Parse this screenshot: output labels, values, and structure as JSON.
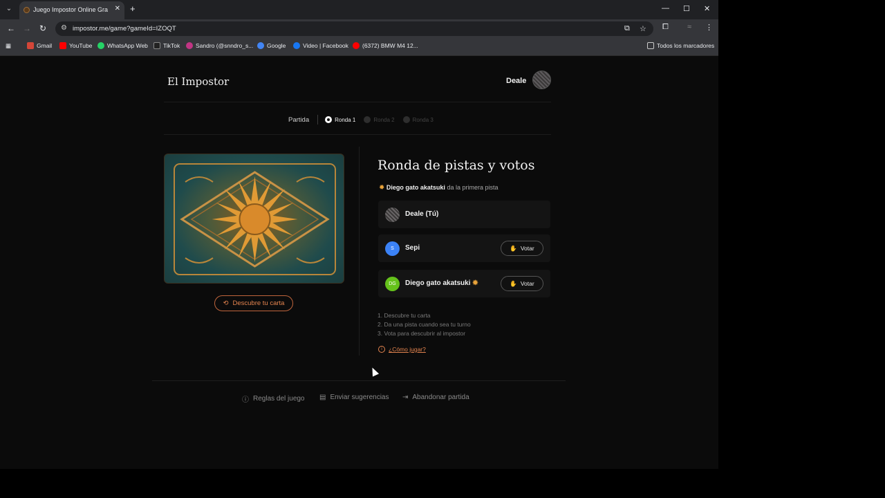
{
  "browser": {
    "tab_title": "Juego Impostor Online Gratis -",
    "url": "impostor.me/game?gameId=IZOQT",
    "bookmarks": [
      {
        "label": "Gmail",
        "color": "#d44638"
      },
      {
        "label": "YouTube",
        "color": "#ff0000"
      },
      {
        "label": "WhatsApp Web",
        "color": "#25d366"
      },
      {
        "label": "TikTok",
        "color": "#222222"
      },
      {
        "label": "Sandro (@snndro_s...",
        "color": "#c13584"
      },
      {
        "label": "Google",
        "color": "#4285f4"
      },
      {
        "label": "Video | Facebook",
        "color": "#1877f2"
      },
      {
        "label": "(6372) BMW M4 12...",
        "color": "#ff0000"
      }
    ],
    "all_bookmarks": "Todos los marcadores"
  },
  "header": {
    "brand": "El Impostor",
    "user_name": "Deale"
  },
  "progress": {
    "label": "Partida",
    "rounds": [
      {
        "label": "Ronda 1",
        "active": true
      },
      {
        "label": "Ronda 2",
        "active": false
      },
      {
        "label": "Ronda 3",
        "active": false
      }
    ]
  },
  "card": {
    "discover_label": "Descubre tu carta"
  },
  "round": {
    "title": "Ronda de pistas y votos",
    "first_clue_player": "Diego gato akatsuki",
    "first_clue_text": "da la primera pista"
  },
  "players": [
    {
      "name": "Deale (Tú)",
      "initials": "",
      "color": "#555555",
      "vote": null
    },
    {
      "name": "Sepi",
      "initials": "S",
      "color": "#3b82f6",
      "vote": "Votar"
    },
    {
      "name": "Diego gato akatsuki",
      "initials": "DG",
      "color": "#65c21b",
      "vote": "Votar"
    }
  ],
  "instructions": [
    "1. Descubre tu carta",
    "2. Da una pista cuando sea tu turno",
    "3. Vota para descubrir al impostor"
  ],
  "how_to_play": "¿Cómo jugar?",
  "footer": {
    "rules": "Reglas del juego",
    "suggestions": "Enviar sugerencias",
    "leave": "Abandonar partida"
  }
}
